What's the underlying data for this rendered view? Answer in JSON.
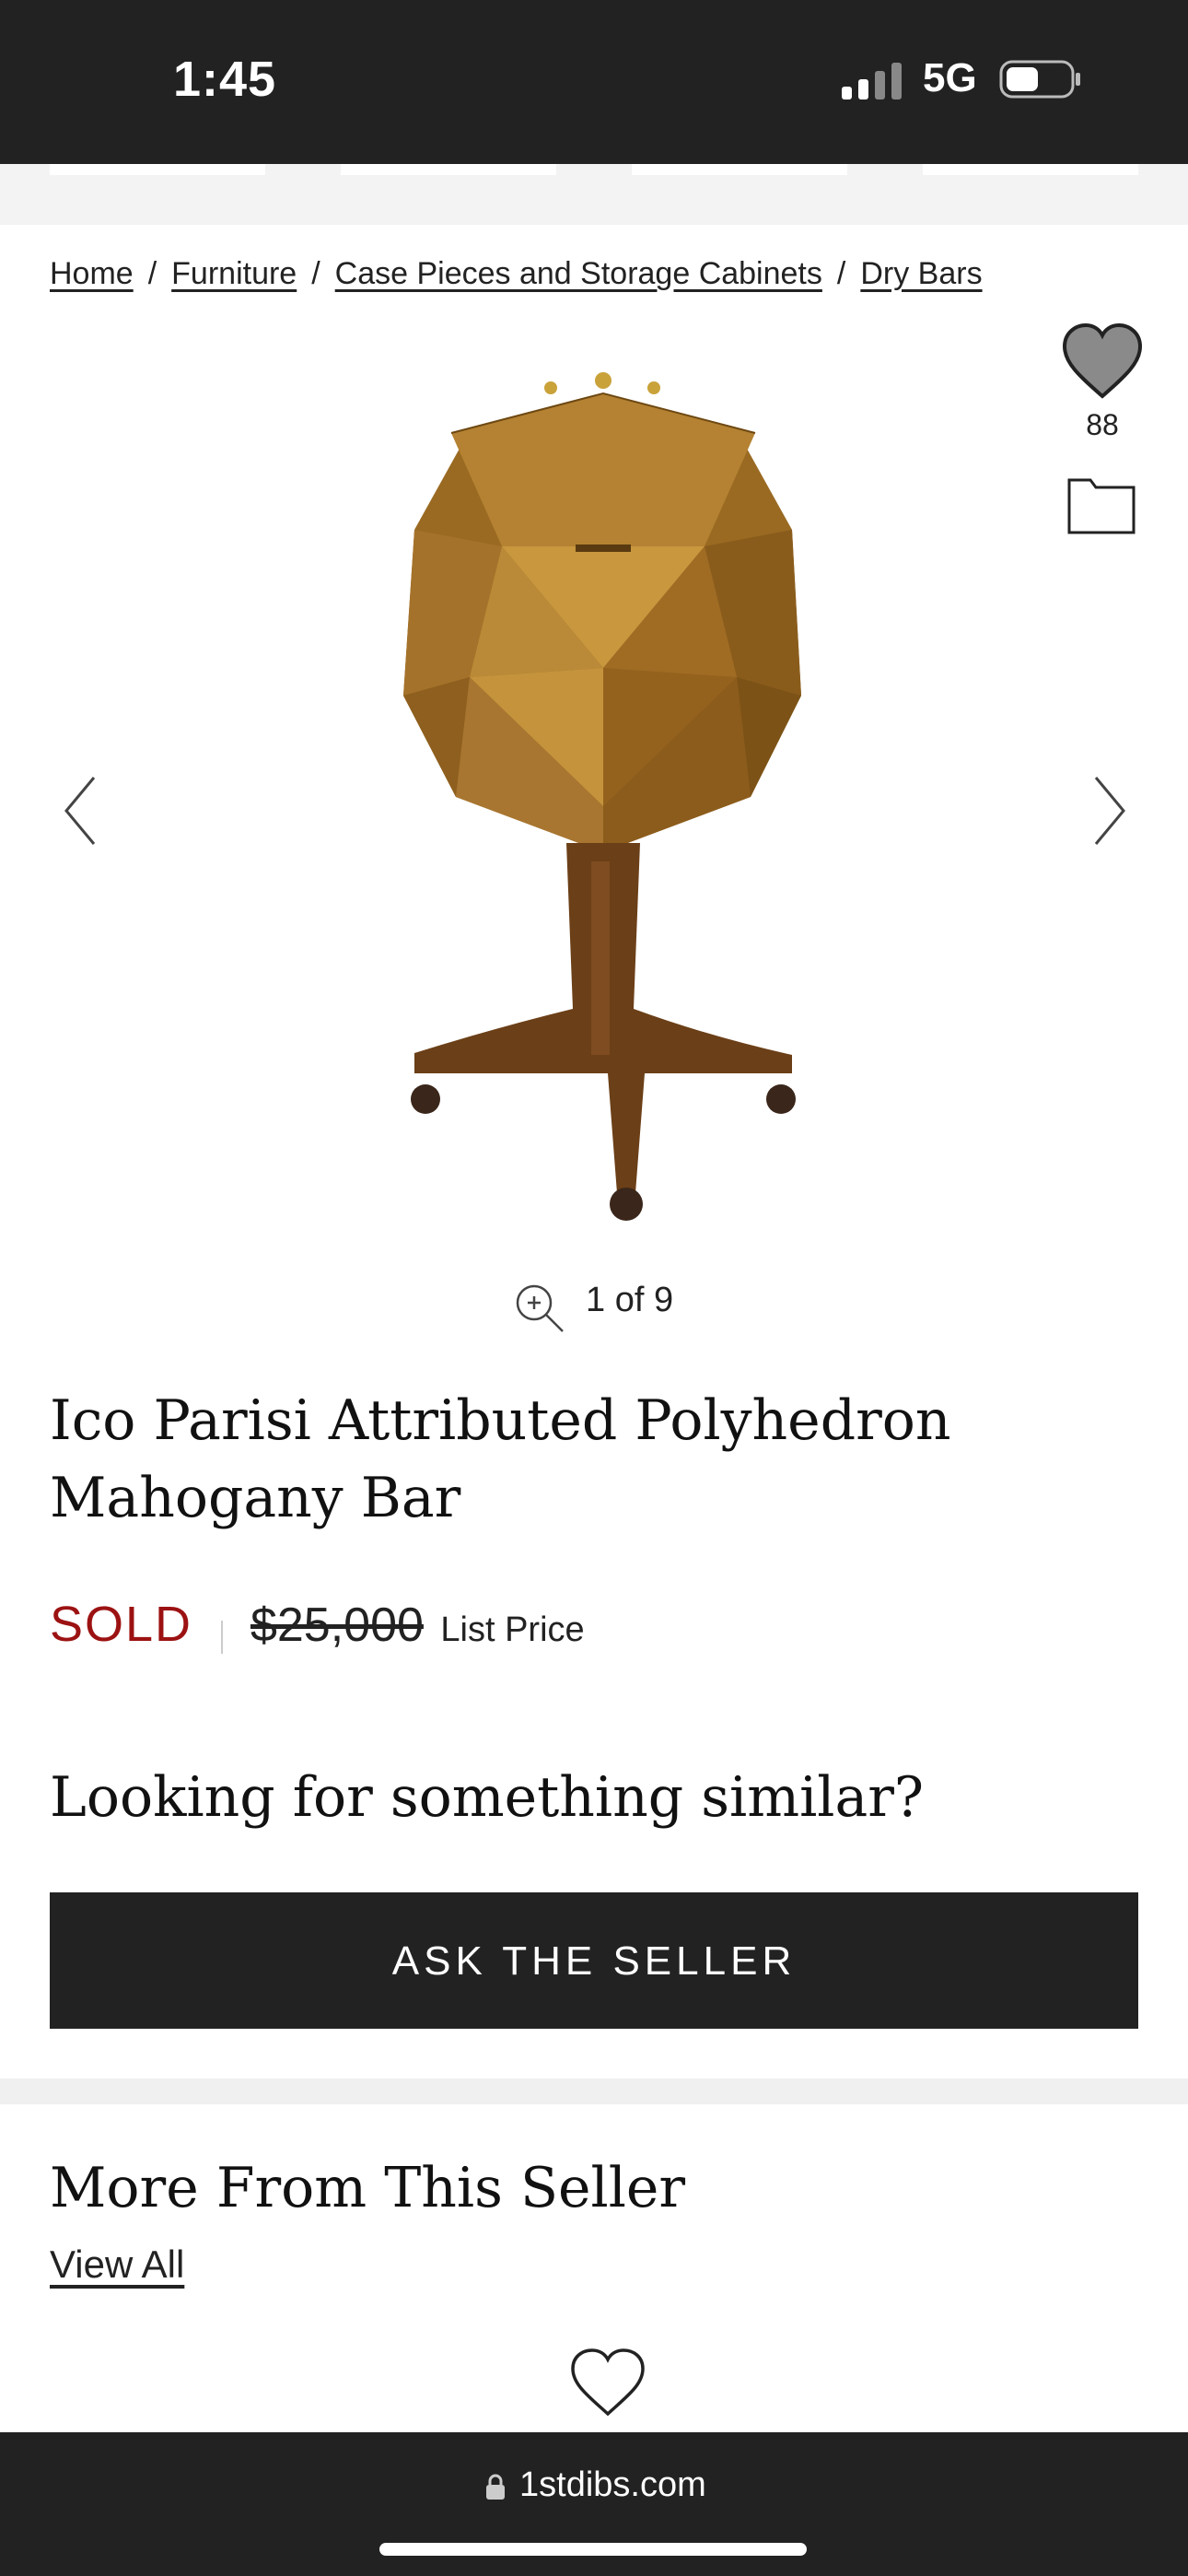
{
  "status_bar": {
    "time": "1:45",
    "network": "5G"
  },
  "breadcrumb": {
    "items": [
      "Home",
      "Furniture",
      "Case Pieces and Storage Cabinets",
      "Dry Bars"
    ],
    "separator": "/"
  },
  "actions": {
    "favorite_count": "88"
  },
  "gallery": {
    "counter": "1 of 9"
  },
  "product": {
    "title": "Ico Parisi Attributed Polyhedron Mahogany Bar",
    "status": "SOLD",
    "price": "$25,000",
    "price_label": "List Price"
  },
  "similar": {
    "heading": "Looking for something similar?",
    "button": "ASK THE SELLER"
  },
  "more": {
    "heading": "More From This Seller",
    "view_all": "View All"
  },
  "browser": {
    "url": "1stdibs.com"
  },
  "colors": {
    "sold": "#9c1212",
    "dark": "#222222"
  }
}
